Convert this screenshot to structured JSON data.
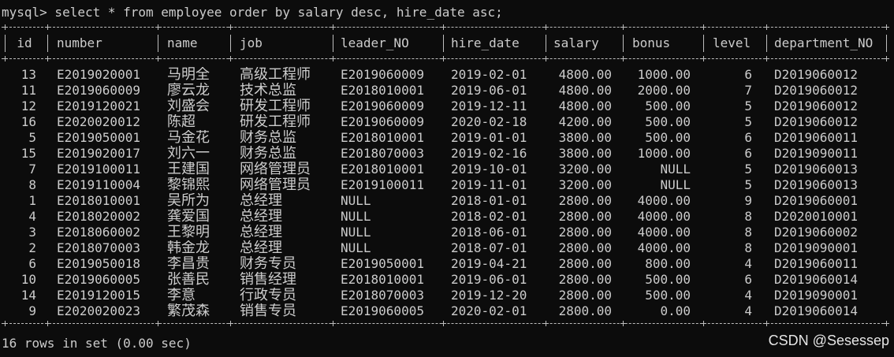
{
  "terminal": {
    "prompt": "mysql>",
    "command": " select * from employee order by salary desc, hire_date asc;",
    "summary": "16 rows in set (0.00 sec)"
  },
  "table": {
    "columns": [
      "id",
      "number",
      "name",
      "job",
      "leader_NO",
      "hire_date",
      "salary",
      "bonus",
      "level",
      "department_NO"
    ],
    "rows": [
      [
        "13",
        "E2019020001",
        "马明全",
        "高级工程师",
        "E2019060009",
        "2019-02-01",
        "4800.00",
        "1000.00",
        "6",
        "D2019060012"
      ],
      [
        "11",
        "E2019060009",
        "廖云龙",
        "技术总监",
        "E2018010001",
        "2019-06-01",
        "4800.00",
        "2000.00",
        "7",
        "D2019060012"
      ],
      [
        "12",
        "E2019120021",
        "刘盛会",
        "研发工程师",
        "E2019060009",
        "2019-12-11",
        "4800.00",
        "500.00",
        "5",
        "D2019060012"
      ],
      [
        "16",
        "E2020020012",
        "陈超",
        "研发工程师",
        "E2019060009",
        "2020-02-18",
        "4200.00",
        "500.00",
        "5",
        "D2019060012"
      ],
      [
        "5",
        "E2019050001",
        "马金花",
        "财务总监",
        "E2018010001",
        "2019-01-01",
        "3800.00",
        "500.00",
        "6",
        "D2019060011"
      ],
      [
        "15",
        "E2019020017",
        "刘六一",
        "财务总监",
        "E2018070003",
        "2019-02-16",
        "3800.00",
        "1000.00",
        "6",
        "D2019090011"
      ],
      [
        "7",
        "E2019100011",
        "王建国",
        "网络管理员",
        "E2018010001",
        "2019-10-01",
        "3200.00",
        "NULL",
        "5",
        "D2019060013"
      ],
      [
        "8",
        "E2019110004",
        "黎锦熙",
        "网络管理员",
        "E2019100011",
        "2019-11-01",
        "3200.00",
        "NULL",
        "5",
        "D2019060013"
      ],
      [
        "1",
        "E2018010001",
        "吴所为",
        "总经理",
        "NULL",
        "2018-01-01",
        "2800.00",
        "4000.00",
        "9",
        "D2019060001"
      ],
      [
        "4",
        "E2018020002",
        "龚爱国",
        "总经理",
        "NULL",
        "2018-02-01",
        "2800.00",
        "4000.00",
        "8",
        "D2020010001"
      ],
      [
        "3",
        "E2018060002",
        "王黎明",
        "总经理",
        "NULL",
        "2018-06-01",
        "2800.00",
        "4000.00",
        "8",
        "D2019060002"
      ],
      [
        "2",
        "E2018070003",
        "韩金龙",
        "总经理",
        "NULL",
        "2018-07-01",
        "2800.00",
        "4000.00",
        "8",
        "D2019090001"
      ],
      [
        "6",
        "E2019050018",
        "李昌贵",
        "财务专员",
        "E2019050001",
        "2019-04-21",
        "2800.00",
        "800.00",
        "4",
        "D2019060011"
      ],
      [
        "10",
        "E2019060005",
        "张善民",
        "销售经理",
        "E2018010001",
        "2019-06-01",
        "2800.00",
        "500.00",
        "6",
        "D2019060014"
      ],
      [
        "14",
        "E2019120015",
        "李意",
        "行政专员",
        "E2018070003",
        "2019-12-20",
        "2800.00",
        "500.00",
        "4",
        "D2019090001"
      ],
      [
        "9",
        "E2020020023",
        "繁茂森",
        "销售专员",
        "E2019060005",
        "2020-02-01",
        "2800.00",
        "0.00",
        "4",
        "D2019060014"
      ]
    ]
  },
  "watermark": "CSDN @Sesessep",
  "colors": {
    "background": "#0c0c0c",
    "text": "#cccccc"
  }
}
